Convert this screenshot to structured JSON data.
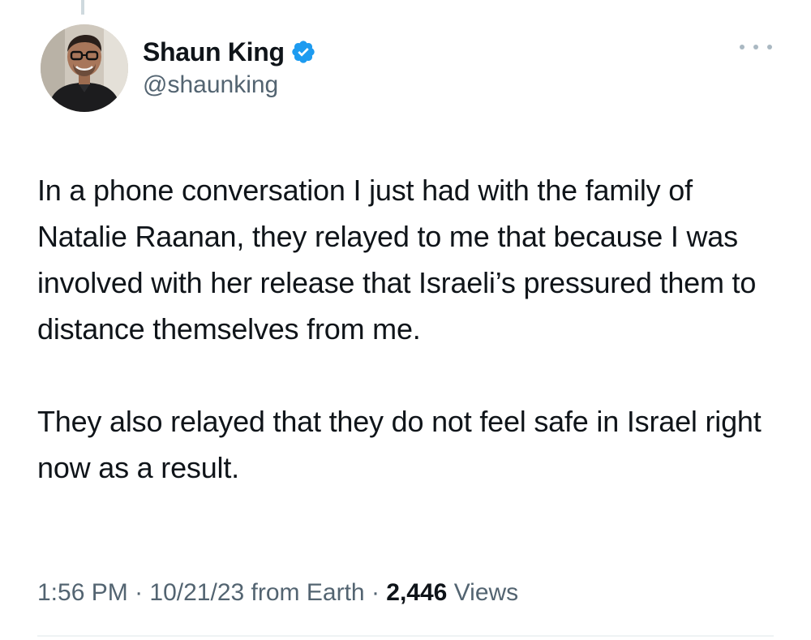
{
  "author": {
    "display_name": "Shaun King",
    "handle": "@shaunking",
    "verified_color": "#1d9bf0",
    "avatar_icon": "profile-photo"
  },
  "tweet": {
    "paragraphs": [
      "In a phone conversation I just had with the family of Natalie Raanan, they relayed to me that because I was involved with her release that Israeli’s pressured them to distance themselves from me.",
      "They also relayed that they do not feel safe in Israel right now as a result."
    ]
  },
  "meta": {
    "time": "1:56 PM",
    "separator": "·",
    "date": "10/21/23",
    "source": "from Earth",
    "views_count": "2,446",
    "views_label": "Views"
  },
  "colors": {
    "text": "#0f1419",
    "secondary": "#536471",
    "accent": "#1d9bf0"
  }
}
